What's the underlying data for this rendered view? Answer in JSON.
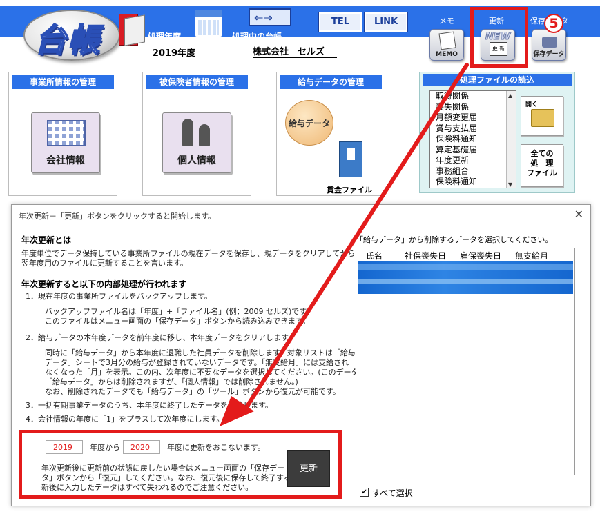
{
  "header": {
    "logo_text": "台帳",
    "processing_year_label": "処理年度",
    "processing_year_value": "2019年度",
    "processing_ledger_label": "処理中の台帳",
    "company_name": "株式会社　セルズ",
    "tel_label": "TEL",
    "link_label": "LINK",
    "memo_label": "メモ",
    "memo_caption": "MEMO",
    "update_label": "更新",
    "update_new": "NEW",
    "update_doc": "更 新",
    "save_label": "保存データ",
    "save_caption": "保存データ",
    "step_number": "5"
  },
  "panels": {
    "office": {
      "title": "事業所情報の管理",
      "button": "会社情報"
    },
    "insured": {
      "title": "被保険者情報の管理",
      "button": "個人情報"
    },
    "salary": {
      "title": "給与データの管理",
      "button": "給与データ",
      "ledger": "賃金ファイル"
    },
    "files": {
      "title": "処理ファイルの読込",
      "items": [
        "取得関係",
        "喪失関係",
        "月額変更届",
        "賞与支払届",
        "保険料通知",
        "算定基礎届",
        "年度更新",
        "事務組合",
        "保険料通知"
      ],
      "open_label": "開く",
      "all_label_1": "全ての",
      "all_label_2": "処　理",
      "all_label_3": "ファイル"
    }
  },
  "dialog": {
    "title": "年次更新－「更新」ボタンをクリックすると開始します。",
    "close": "✕",
    "h1": "年次更新とは",
    "p1a": "年度単位でデータ保持している事業所ファイルの現在データを保存し、現データをクリアしてから",
    "p1b": "翌年度用のファイルに更新することを言います。",
    "h2": "年次更新すると以下の内部処理が行われます",
    "s1": "1．現在年度の事業所ファイルをバックアップします。",
    "s1a": "バックアップファイル名は「年度」+「ファイル名」(例：2009 セルズ)です。",
    "s1b": "このファイルはメニュー画面の「保存データ」ボタンから読み込みできます。",
    "s2": "2．給与データの本年度データを前年度に移し、本年度データをクリアします。",
    "s2a": "同時に「給与データ」から本年度に退職した社員データを削除します。対象リストは「給与",
    "s2b": "データ」シートで3月分の給与が登録されていないデータです。「無支給月」には支給され",
    "s2c": "なくなった「月」を表示。この内、次年度に不要なデータを選択してください。(このデータは",
    "s2d": "「給与データ」からは削除されますが、「個人情報」では削除されません。)",
    "s2e": "なお、削除されたデータでも「給与データ」の「ツール」ボタンから復元が可能です。",
    "s3": "3．一括有期事業データのうち、本年度に終了したデータを削除します。",
    "s4": "4．会社情報の年度に「1」をプラスして次年度にします。",
    "from_year": "2019",
    "from_label": "年度から",
    "to_year": "2020",
    "to_label": "年度に更新をおこないます。",
    "note1": "年次更新後に更新前の状態に戻したい場合はメニュー画面の「保存デー",
    "note2": "タ」ボタンから「復元」してください。なお、復元後に保存して終了すると、更",
    "note3": "新後に入力したデータはすべて失われるのでご注意ください。",
    "update_button": "更新",
    "delete_label": "「給与データ」から削除するデータを選択してください。",
    "columns": [
      "氏名",
      "社保喪失日",
      "雇保喪失日",
      "無支給月"
    ],
    "select_all": "すべて選択",
    "select_all_mark": "✔"
  },
  "colors": {
    "header_blue": "#2b71e8",
    "highlight_red": "#e31b1b",
    "list_select": "#1a74d6"
  }
}
